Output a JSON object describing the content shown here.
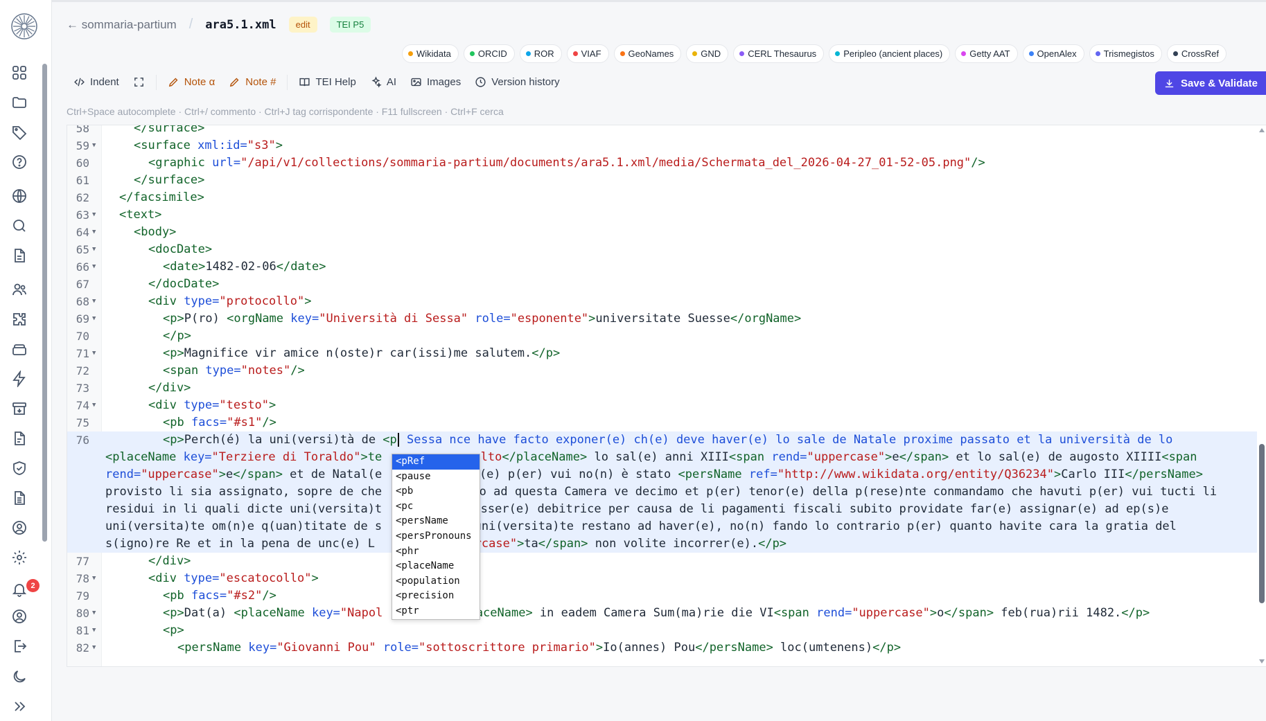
{
  "breadcrumb": {
    "back_label": "← sommaria-partium",
    "separator": "/",
    "file": "ara5.1.xml",
    "mode_badge": "edit",
    "schema_badge": "TEI P5"
  },
  "authorities": [
    {
      "label": "Wikidata",
      "color": "#f59e0b"
    },
    {
      "label": "ORCID",
      "color": "#22c55e"
    },
    {
      "label": "ROR",
      "color": "#0ea5e9"
    },
    {
      "label": "VIAF",
      "color": "#ef4444"
    },
    {
      "label": "GeoNames",
      "color": "#f97316"
    },
    {
      "label": "GND",
      "color": "#eab308"
    },
    {
      "label": "CERL Thesaurus",
      "color": "#8b5cf6"
    },
    {
      "label": "Peripleo (ancient places)",
      "color": "#06b6d4"
    },
    {
      "label": "Getty AAT",
      "color": "#d946ef"
    },
    {
      "label": "OpenAlex",
      "color": "#3b82f6"
    },
    {
      "label": "Trismegistos",
      "color": "#6366f1"
    },
    {
      "label": "CrossRef",
      "color": "#334155"
    }
  ],
  "toolbar": {
    "indent": "Indent",
    "note_alpha": "Note α",
    "note_hash": "Note #",
    "tei_help": "TEI Help",
    "ai": "AI",
    "images": "Images",
    "version_history": "Version history",
    "save": "Save & Validate"
  },
  "shortcuts_hint": "Ctrl+Space autocomplete · Ctrl+/ commento · Ctrl+J tag corrispondente · F11 fullscreen · Ctrl+F cerca",
  "notifications_count": "2",
  "editor": {
    "line_numbers": [
      "58",
      "59",
      "60",
      "61",
      "62",
      "63",
      "64",
      "65",
      "66",
      "67",
      "68",
      "69",
      "70",
      "71",
      "72",
      "73",
      "74",
      "75",
      "76",
      "77",
      "78",
      "79",
      "80",
      "81",
      "82"
    ],
    "tokens": {
      "l58": "</surface>",
      "l59a": "<surface",
      "l59b": " xml:id=",
      "l59c": "\"s3\"",
      "l59d": ">",
      "l60a": "<graphic",
      "l60b": " url=",
      "l60c": "\"/api/v1/collections/sommaria-partium/documents/ara5.1.xml/media/Schermata_del_2026-04-27_01-52-05.png\"",
      "l60d": "/>",
      "l61": "</surface>",
      "l62": "</facsimile>",
      "l63": "<text>",
      "l64": "<body>",
      "l65": "<docDate>",
      "l66a": "<date>",
      "l66b": "1482-02-06",
      "l66c": "</date>",
      "l67": "</docDate>",
      "l68a": "<div",
      "l68b": " type=",
      "l68c": "\"protocollo\"",
      "l68d": ">",
      "l69a": "<p>",
      "l69b": "P(ro) ",
      "l69c": "<orgName",
      "l69d": " key=",
      "l69e": "\"Università di Sessa\"",
      "l69f": " role=",
      "l69g": "\"esponente\"",
      "l69h": ">",
      "l69i": "universitate Suesse",
      "l69j": "</orgName>",
      "l70": "</p>",
      "l71a": "<p>",
      "l71b": "Magnifice vir amice n(oste)r car(issi)me salutem.",
      "l71c": "</p>",
      "l72a": "<span",
      "l72b": " type=",
      "l72c": "\"notes\"",
      "l72d": "/>",
      "l73": "</div>",
      "l74a": "<div",
      "l74b": " type=",
      "l74c": "\"testo\"",
      "l74d": ">",
      "l75a": "<pb",
      "l75b": " facs=",
      "l75c": "\"#s1\"",
      "l75d": "/>",
      "l76a1": "<p>",
      "l76a2": "Perch(é) la uni(versi)tà de ",
      "l76a3": "<p",
      "l76a4": " Sessa nce have facto exponer(e) ch(e) deve haver(e) lo sale de Natale proxime passato et la università de lo",
      "l76b1": "<placeName",
      "l76b2": " key=",
      "l76b3": "\"Terziere di Toraldo\"",
      "l76b4": ">te",
      "l76b5": "ralto",
      "l76b6": "</placeName>",
      "l76b7": " lo sal(e) anni XIII",
      "l76b8": "<span",
      "l76b9": " rend=",
      "l76b10": "\"uppercase\"",
      "l76b11": ">",
      "l76b12": "e",
      "l76b13": "</span>",
      "l76b14": " et lo sal(e) de augosto XIIII",
      "l76b15": "<span",
      "l76c1": "rend=",
      "l76c2": "\"uppercase\"",
      "l76c3": ">",
      "l76c4": "e",
      "l76c5": "</span>",
      "l76c6": " et de Natal(e",
      "l76c7": " ch(e) p(er) vui no(n) è stato ",
      "l76c8": "<persName",
      "l76c9": " ref=",
      "l76c10": "\"http://www.wikidata.org/entity/Q36234\"",
      "l76c11": ">",
      "l76c12": "Carlo III",
      "l76c13": "</persName>",
      "l76d1": "provisto li sia assignato, sopre de che",
      "l76d2": "rso ad questa Camera ve decimo et p(er) tenor(e) della p(rese)nte conmandamo che havuti p(er) vui tucti li",
      "l76e1": "residui in li quali dicte uni(versita)t",
      "l76e2": " esser(e) debitrice per causa de li pagamenti fiscali subito providate far(e) assignar(e) ad ep(s)e",
      "l76f1": "uni(versita)te om(n)e q(uan)titate de s",
      "l76f2": "e uni(versita)te restano ad haver(e), no(n) fando lo contrario p(er) quanto havite cara la gratia del",
      "l76g1": "s(igno)re Re et in la pena de unc(e) L",
      "l76g2": "ppercase\"",
      "l76g3": ">",
      "l76g4": "ta",
      "l76g5": "</span>",
      "l76g6": " non volite incorrer(e).",
      "l76g7": "</p>",
      "l77": "</div>",
      "l78a": "<div",
      "l78b": " type=",
      "l78c": "\"escatocollo\"",
      "l78d": ">",
      "l79a": "<pb",
      "l79b": " facs=",
      "l79c": "\"#s2\"",
      "l79d": "/>",
      "l80a": "<p>",
      "l80b": "Dat(a) ",
      "l80c": "<placeName",
      "l80d": " key=",
      "l80e": "\"Napol",
      "l80f": "placeName>",
      "l80g": " in eadem Camera Sum(ma)rie die VI",
      "l80h": "<span",
      "l80i": " rend=",
      "l80j": "\"uppercase\"",
      "l80k": ">",
      "l80l": "o",
      "l80m": "</span>",
      "l80n": " feb(rua)rii 1482.",
      "l80o": "</p>",
      "l81": "<p>",
      "l82a": "<persName",
      "l82b": " key=",
      "l82c": "\"Giovanni Pou\"",
      "l82d": " role=",
      "l82e": "\"sottoscrittore primario\"",
      "l82f": ">",
      "l82g": "Io(annes) Pou",
      "l82h": "</persName>",
      "l82i": " loc(umtenens)",
      "l82j": "</p>"
    }
  },
  "autocomplete": {
    "items": [
      "<pRef",
      "<pause",
      "<pb",
      "<pc",
      "<persName",
      "<persPronouns",
      "<phr",
      "<placeName",
      "<population",
      "<precision",
      "<ptr"
    ],
    "selected": "<pRef"
  }
}
